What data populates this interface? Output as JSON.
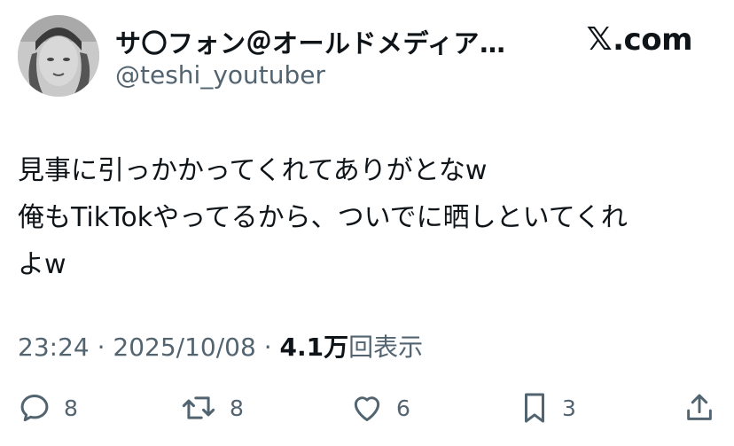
{
  "author": {
    "display_name": "サ〇フォン＠オールドメディア…",
    "handle": "@teshi_youtuber"
  },
  "brand": {
    "logo_glyph": "𝕏",
    "domain_text": ".com"
  },
  "tweet": {
    "lines": [
      "見事に引っかかってくれてありがとなw",
      "俺もTikTokやってるから、ついでに晒しといてくれ",
      "よw"
    ]
  },
  "meta": {
    "time": "23:24",
    "separator": "·",
    "date": "2025/10/08",
    "views_count": "4.1万",
    "views_label": "回表示"
  },
  "actions": {
    "reply_icon": "reply-icon",
    "reply_count": "8",
    "retweet_icon": "retweet-icon",
    "retweet_count": "8",
    "like_icon": "heart-icon",
    "like_count": "6",
    "bookmark_icon": "bookmark-icon",
    "bookmark_count": "3",
    "share_icon": "share-icon"
  },
  "colors": {
    "text_primary": "#0f1419",
    "text_secondary": "#536471",
    "background": "#ffffff"
  }
}
